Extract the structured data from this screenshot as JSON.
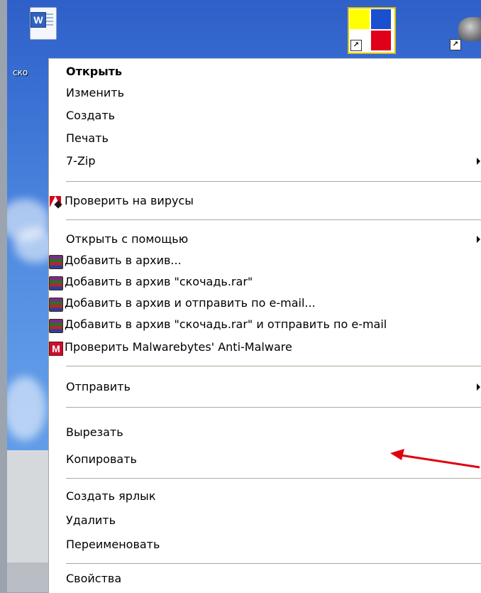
{
  "desktop": {
    "file_label": "ско"
  },
  "menu": {
    "items": [
      {
        "label": "Открыть"
      },
      {
        "label": "Изменить"
      },
      {
        "label": "Создать"
      },
      {
        "label": "Печать"
      },
      {
        "label": "7-Zip"
      },
      {
        "label": "Проверить на вирусы",
        "icon": "kaspersky-icon"
      },
      {
        "label": "Открыть с помощью"
      },
      {
        "label": "Добавить в архив...",
        "icon": "winrar-icon"
      },
      {
        "label": "Добавить в архив \"скочадь.rar\"",
        "icon": "winrar-icon"
      },
      {
        "label": "Добавить в архив и отправить по e-mail...",
        "icon": "winrar-icon"
      },
      {
        "label": "Добавить в архив \"скочадь.rar\" и отправить по e-mail",
        "icon": "winrar-icon"
      },
      {
        "label": "Проверить Malwarebytes' Anti-Malware",
        "icon": "malwarebytes-icon"
      },
      {
        "label": "Отправить"
      },
      {
        "label": "Вырезать"
      },
      {
        "label": "Копировать"
      },
      {
        "label": "Создать ярлык"
      },
      {
        "label": "Удалить"
      },
      {
        "label": "Переименовать"
      },
      {
        "label": "Свойства"
      }
    ]
  },
  "colors": {
    "desktop_blue": "#3b72d4",
    "menu_bg": "#ffffff",
    "separator": "#aca899",
    "annotation_red": "#e0000f"
  }
}
